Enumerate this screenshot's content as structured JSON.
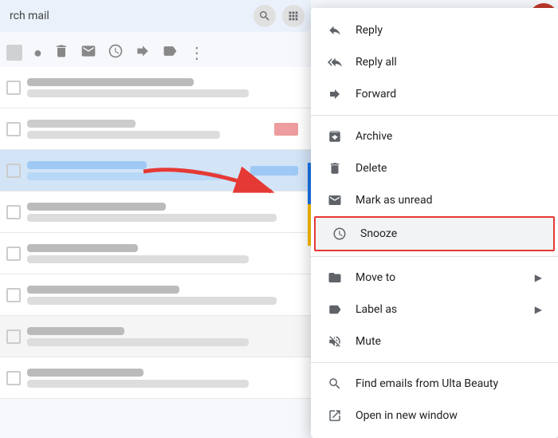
{
  "header": {
    "search_placeholder": "rch mail"
  },
  "top_icons": [
    "checkbox",
    "important",
    "delete",
    "mail",
    "snooze",
    "forward",
    "label",
    "more"
  ],
  "email_rows": [
    {
      "id": 1,
      "style": "normal"
    },
    {
      "id": 2,
      "style": "normal"
    },
    {
      "id": 3,
      "style": "highlighted"
    },
    {
      "id": 4,
      "style": "normal"
    },
    {
      "id": 5,
      "style": "normal"
    },
    {
      "id": 6,
      "style": "normal"
    },
    {
      "id": 7,
      "style": "gray"
    }
  ],
  "context_menu": {
    "items": [
      {
        "id": "reply",
        "label": "Reply",
        "icon": "reply",
        "has_submenu": false
      },
      {
        "id": "reply-all",
        "label": "Reply all",
        "icon": "reply-all",
        "has_submenu": false
      },
      {
        "id": "forward",
        "label": "Forward",
        "icon": "forward",
        "has_submenu": false
      },
      {
        "id": "divider1"
      },
      {
        "id": "archive",
        "label": "Archive",
        "icon": "archive",
        "has_submenu": false
      },
      {
        "id": "delete",
        "label": "Delete",
        "icon": "delete",
        "has_submenu": false
      },
      {
        "id": "mark-unread",
        "label": "Mark as unread",
        "icon": "mark-unread",
        "has_submenu": false
      },
      {
        "id": "snooze",
        "label": "Snooze",
        "icon": "snooze",
        "has_submenu": false,
        "highlighted": true
      },
      {
        "id": "divider2"
      },
      {
        "id": "move-to",
        "label": "Move to",
        "icon": "move-to",
        "has_submenu": true
      },
      {
        "id": "label-as",
        "label": "Label as",
        "icon": "label-as",
        "has_submenu": true
      },
      {
        "id": "mute",
        "label": "Mute",
        "icon": "mute",
        "has_submenu": false
      },
      {
        "id": "divider3"
      },
      {
        "id": "find-emails",
        "label": "Find emails from Ulta Beauty",
        "icon": "search",
        "has_submenu": false
      },
      {
        "id": "open-new-window",
        "label": "Open in new window",
        "icon": "open-new",
        "has_submenu": false
      }
    ]
  },
  "arrow": {
    "color": "#e53935"
  }
}
